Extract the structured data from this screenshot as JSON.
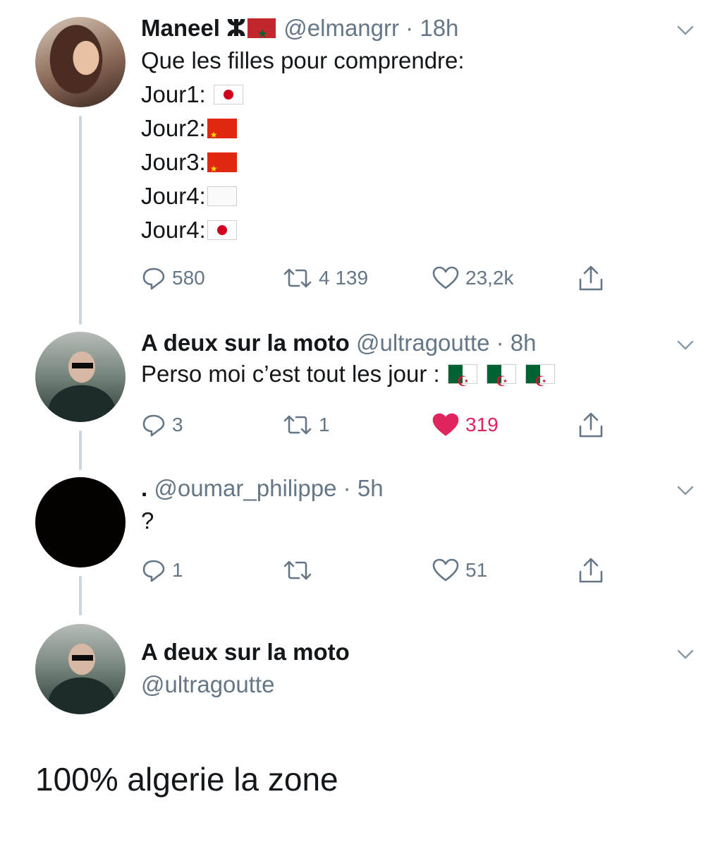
{
  "tweets": [
    {
      "name": "Maneel",
      "name_suffix": "ⵣ",
      "handle": "@elmangrr",
      "separator": "·",
      "time": "18h",
      "text_lines": [
        {
          "text": "Que les filles pour comprendre:"
        },
        {
          "text": "Jour1: ",
          "flags": [
            "japan"
          ]
        },
        {
          "text": "Jour2:",
          "flags": [
            "china"
          ]
        },
        {
          "text": "Jour3:",
          "flags": [
            "china"
          ]
        },
        {
          "text": "Jour4:",
          "flags": [
            "white"
          ]
        },
        {
          "text": "Jour4:",
          "flags": [
            "japan"
          ]
        }
      ],
      "replies": "580",
      "retweets": "4 139",
      "likes": "23,2k",
      "liked": false
    },
    {
      "name": "A deux sur la moto",
      "handle": "@ultragoutte",
      "separator": "·",
      "time": "8h",
      "text_lines": [
        {
          "text": "Perso moi c’est tout les jour : ",
          "flags": [
            "algeria",
            "algeria",
            "algeria"
          ]
        }
      ],
      "replies": "3",
      "retweets": "1",
      "likes": "319",
      "liked": true
    },
    {
      "name": ".",
      "handle": "@oumar_philippe",
      "separator": "·",
      "time": "5h",
      "text_lines": [
        {
          "text": "?"
        }
      ],
      "replies": "1",
      "retweets": "",
      "likes": "51",
      "liked": false
    }
  ],
  "quoted_author": {
    "name": "A deux sur la moto",
    "handle": "@ultragoutte"
  },
  "main_text": "100% algerie la zone",
  "colors": {
    "text": "#14171a",
    "secondary": "#657786",
    "like_active": "#e0245e",
    "thread_line": "#cdd6dd"
  },
  "icons": [
    "reply-icon",
    "retweet-icon",
    "like-icon",
    "share-icon",
    "chevron-down-icon"
  ]
}
